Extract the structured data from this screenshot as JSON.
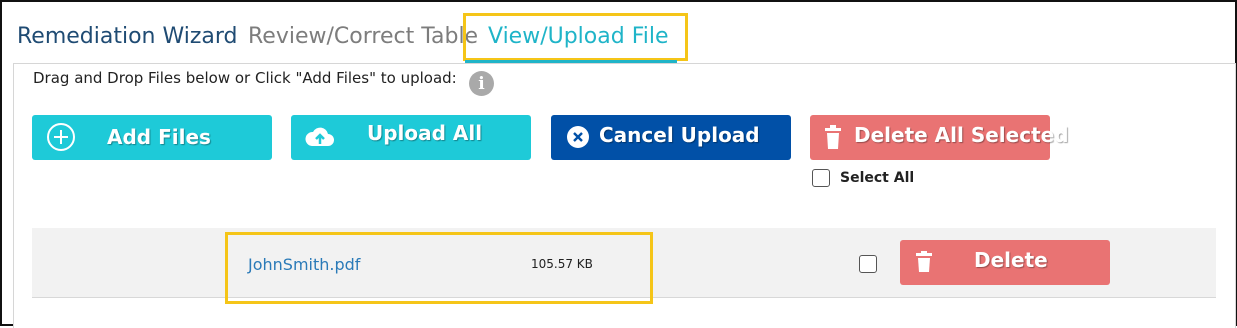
{
  "tabs": [
    {
      "label": "Remediation Wizard"
    },
    {
      "label": "Review/Correct Table"
    },
    {
      "label": "View/Upload File",
      "active": true
    }
  ],
  "instructions": "Drag and Drop Files below or Click \"Add Files\" to upload:",
  "info_icon": {
    "glyph": "i"
  },
  "buttons": {
    "add_files": "Add Files",
    "upload_all": "Upload All",
    "cancel_upload": "Cancel Upload",
    "delete_all_selected": "Delete All Selected"
  },
  "select_all_label": "Select All",
  "files": [
    {
      "name": "JohnSmith.pdf",
      "size": "105.57 KB",
      "delete_label": "Delete"
    }
  ],
  "colors": {
    "accent_teal": "#1ecad8",
    "cancel_blue": "#0150a7",
    "delete_red": "#e97373",
    "highlight_yellow": "#f5c518",
    "active_tab": "#1fb4c8",
    "link_blue": "#2a7ab8"
  },
  "icons": {
    "add": "plus-circle-icon",
    "upload": "cloud-upload-icon",
    "cancel": "x-circle-icon",
    "delete": "trash-icon",
    "info": "info-icon"
  }
}
